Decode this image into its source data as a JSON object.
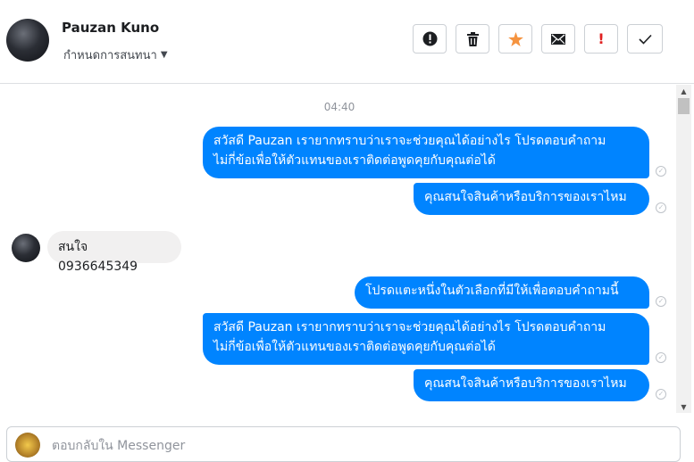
{
  "header": {
    "contact_name": "Pauzan Kuno",
    "conversation_settings": "กำหนดการสนทนา",
    "toolbar": [
      {
        "name": "alert-circle",
        "glyph": "!",
        "color": "#1c1e21"
      },
      {
        "name": "trash",
        "glyph": "🗑",
        "color": "#1c1e21"
      },
      {
        "name": "star",
        "glyph": "★",
        "color": "#f5933f"
      },
      {
        "name": "envelope",
        "glyph": "✉",
        "color": "#1c1e21"
      },
      {
        "name": "exclamation",
        "glyph": "!",
        "color": "#e02020"
      },
      {
        "name": "check",
        "glyph": "✓",
        "color": "#1c1e21"
      }
    ]
  },
  "thread": {
    "timestamp": "04:40",
    "messages": [
      {
        "from": "page",
        "lines": [
          "สวัสดี Pauzan เรายากทราบว่าเราจะช่วยคุณได้อย่างไร โปรดตอบคำถาม",
          "ไม่กี่ข้อเพื่อให้ตัวแทนของเราติดต่อพูดคุยกับคุณต่อได้"
        ]
      },
      {
        "from": "page",
        "lines": [
          "คุณสนใจสินค้าหรือบริการของเราไหม"
        ]
      },
      {
        "from": "user",
        "lines": [
          "สนใจ 0936645349"
        ]
      },
      {
        "from": "page",
        "lines": [
          "โปรดแตะหนึ่งในตัวเลือกที่มีให้เพื่อตอบคำถามนี้"
        ]
      },
      {
        "from": "page",
        "lines": [
          "สวัสดี Pauzan เรายากทราบว่าเราจะช่วยคุณได้อย่างไร โปรดตอบคำถาม",
          "ไม่กี่ข้อเพื่อให้ตัวแทนของเราติดต่อพูดคุยกับคุณต่อได้"
        ]
      },
      {
        "from": "page",
        "lines": [
          "คุณสนใจสินค้าหรือบริการของเราไหม"
        ]
      }
    ]
  },
  "composer": {
    "placeholder": "ตอบกลับใน Messenger"
  },
  "colors": {
    "outgoing_bubble": "#0084ff",
    "incoming_bubble": "#f1f0f0",
    "star": "#f5933f",
    "flag": "#e02020"
  }
}
